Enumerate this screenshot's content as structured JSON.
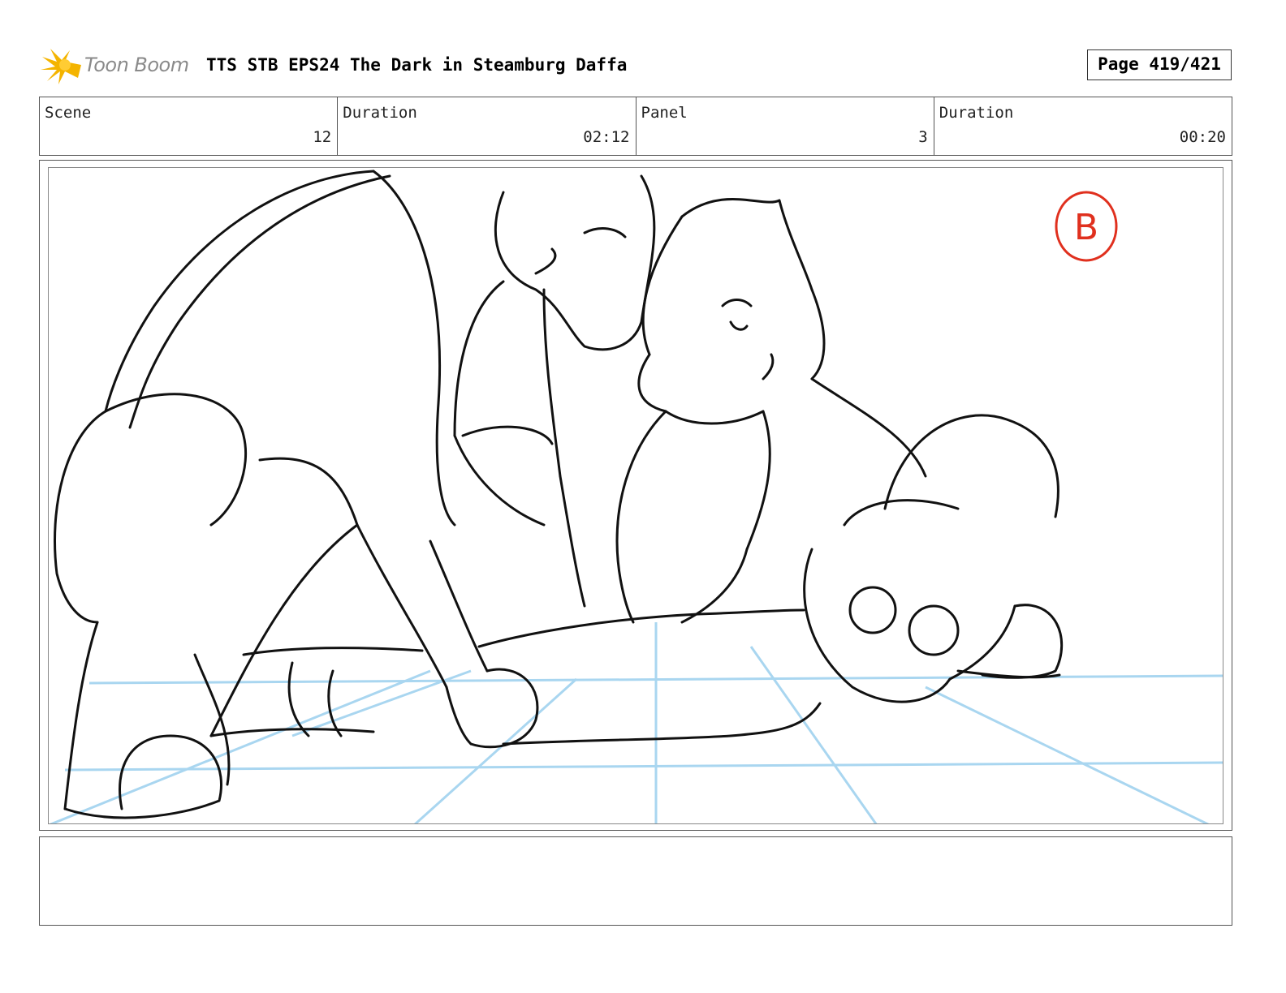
{
  "header": {
    "logo_text": "Toon Boom",
    "title": "TTS STB EPS24 The Dark in Steamburg Daffa",
    "page_label": "Page 419/421"
  },
  "info": {
    "scene": {
      "label": "Scene",
      "value": "12"
    },
    "scene_duration": {
      "label": "Duration",
      "value": "02:12"
    },
    "panel": {
      "label": "Panel",
      "value": "3"
    },
    "panel_duration": {
      "label": "Duration",
      "value": "00:20"
    }
  },
  "drawing": {
    "panel_marker": "B",
    "line_color": "#111111",
    "guide_color": "#a9d6f0",
    "marker_color": "#e0301e",
    "subject": "storyboard-sketch"
  },
  "notes": {
    "text": ""
  },
  "colors": {
    "logo_accent": "#f4b400",
    "border": "#555555"
  }
}
